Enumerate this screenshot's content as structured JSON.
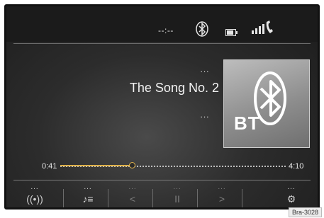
{
  "status": {
    "clock": "--:--",
    "icons": [
      "bluetooth-icon",
      "battery-icon",
      "signal-phone-icon"
    ]
  },
  "track": {
    "top_placeholder": "...",
    "title": "The Song No. 2",
    "bottom_placeholder": "...",
    "art_label": "BT"
  },
  "progress": {
    "elapsed": "0:41",
    "total": "4:10",
    "fraction": 0.32
  },
  "softkeys": [
    {
      "id": "bt-audio",
      "dots": "...",
      "icon": "bluetooth-audio-icon",
      "glyph": "((•))",
      "enabled": true
    },
    {
      "id": "playlist",
      "dots": "...",
      "icon": "playlist-icon",
      "glyph": "♪≡",
      "enabled": true
    },
    {
      "id": "previous",
      "dots": "...",
      "icon": "previous-icon",
      "glyph": "<",
      "enabled": false
    },
    {
      "id": "pause",
      "dots": "...",
      "icon": "pause-icon",
      "glyph": "II",
      "enabled": false
    },
    {
      "id": "next",
      "dots": "...",
      "icon": "next-icon",
      "glyph": ">",
      "enabled": false
    },
    {
      "id": "settings",
      "dots": "...",
      "icon": "settings-icon",
      "glyph": "⚙",
      "enabled": true
    }
  ],
  "colors": {
    "progress_accent": "#e0b24a",
    "screen_background": "#2c2c2c"
  },
  "figure_label": "Bra-3028"
}
